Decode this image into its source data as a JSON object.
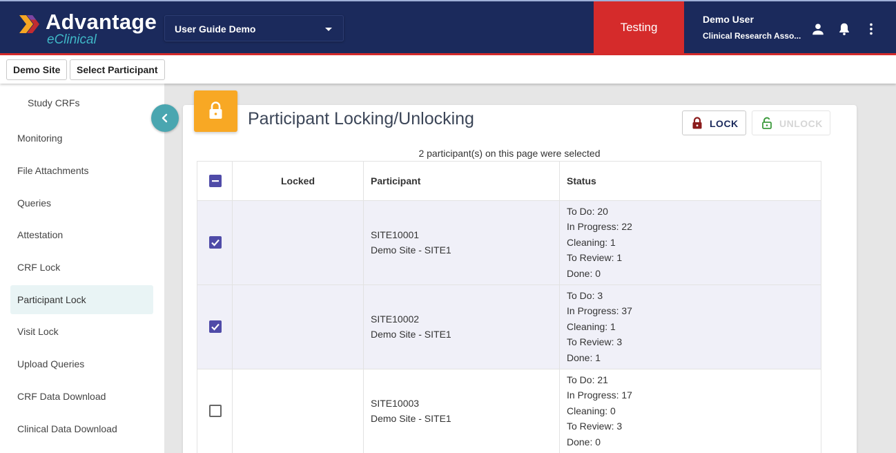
{
  "header": {
    "brand": "Advantage",
    "brand_sub": "eClinical",
    "study": "User Guide Demo",
    "environment": "Testing",
    "user_name": "Demo User",
    "user_role": "Clinical Research Asso...",
    "icons": [
      "person-icon",
      "bell-icon",
      "more-vert-icon"
    ],
    "colors": {
      "navy": "#1b2a5c",
      "red": "#d52b2b",
      "teal": "#3fb7c6"
    }
  },
  "breadcrumbs": [
    "Demo Site",
    "Select Participant"
  ],
  "sidebar": {
    "items": [
      {
        "label": "Study CRFs"
      },
      {
        "label": "Monitoring"
      },
      {
        "label": "File Attachments"
      },
      {
        "label": "Queries"
      },
      {
        "label": "Attestation"
      },
      {
        "label": "CRF Lock"
      },
      {
        "label": "Participant Lock",
        "active": true
      },
      {
        "label": "Visit Lock"
      },
      {
        "label": "Upload Queries"
      },
      {
        "label": "CRF Data Download"
      },
      {
        "label": "Clinical Data Download"
      }
    ]
  },
  "page": {
    "title": "Participant Locking/Unlocking",
    "lock_label": "LOCK",
    "unlock_label": "UNLOCK",
    "selected_note": "2 participant(s) on this page were selected",
    "accent": "#f8a824"
  },
  "table": {
    "headers": {
      "locked": "Locked",
      "participant": "Participant",
      "status": "Status"
    },
    "rows": [
      {
        "checked": true,
        "id": "SITE10001",
        "site": "Demo Site - SITE1",
        "status": [
          "To Do: 20",
          "In Progress: 22",
          "Cleaning: 1",
          "To Review: 1",
          "Done: 0"
        ]
      },
      {
        "checked": true,
        "id": "SITE10002",
        "site": "Demo Site - SITE1",
        "status": [
          "To Do: 3",
          "In Progress: 37",
          "Cleaning: 1",
          "To Review: 3",
          "Done: 1"
        ]
      },
      {
        "checked": false,
        "id": "SITE10003",
        "site": "Demo Site - SITE1",
        "status": [
          "To Do: 21",
          "In Progress: 17",
          "Cleaning: 0",
          "To Review: 3",
          "Done: 0"
        ]
      }
    ]
  }
}
